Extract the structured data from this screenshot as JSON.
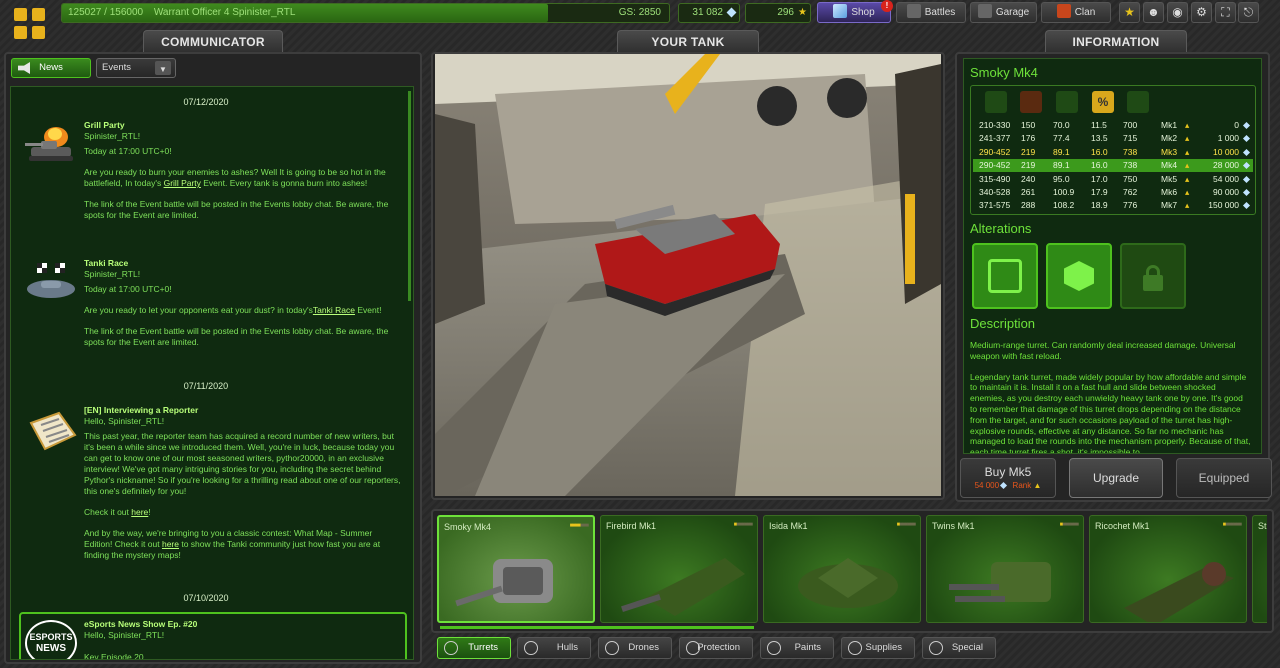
{
  "topbar": {
    "xp": "125027 / 156000",
    "xp_fraction": 0.8,
    "rank_name": "Warrant Officer 4 Spinister_RTL",
    "gs": "GS: 2850",
    "crystals": "31 082",
    "stars": "296",
    "shop": "Shop",
    "shop_badge": "!",
    "battles": "Battles",
    "garage": "Garage",
    "clan": "Clan"
  },
  "sections": {
    "communicator": "COMMUNICATOR",
    "your_tank": "YOUR TANK",
    "information": "INFORMATION"
  },
  "communicator": {
    "news_tab": "News",
    "events_dropdown": "Events",
    "dates": [
      "07/12/2020",
      "07/11/2020",
      "07/10/2020"
    ],
    "posts": [
      {
        "title": "Grill Party",
        "greeting": "Spinister_RTL!",
        "time": "Today at 17:00 UTC+0!",
        "p1a": "Are you ready to burn your enemies to ashes? Well It is going to be so hot in the battlefield, In today's ",
        "link": "Grill Party",
        "p1b": " Event. Every tank is gonna burn into ashes!",
        "p2": "The link of the Event battle will be posted in the Events lobby chat. Be aware, the spots for the Event are limited."
      },
      {
        "title": "Tanki Race",
        "greeting": "Spinister_RTL!",
        "time": "Today at 17:00 UTC+0!",
        "p1a": "Are you ready to let your opponents eat your dust? in today's",
        "link": "Tanki Race",
        "p1b": " Event!",
        "p2": "The link of the Event battle will be posted in the Events lobby chat. Be aware, the spots for the Event are limited."
      },
      {
        "title": "[EN] Interviewing a Reporter",
        "greeting": "Hello, Spinister_RTL!",
        "p1": "This past year, the reporter team has acquired a record number of new writers, but it's been a while since we introduced them. Well, you're in luck, because today you can get to know one of our most seasoned writers, pythor20000, in an exclusive interview! We've got many intriguing stories for you, including the secret behind Pythor's nickname! So if you're looking for a thrilling read about one of our reporters, this one's definitely for you!",
        "p2a": "Check it out ",
        "p2link": "here",
        "p2b": "!",
        "p3a": "And by the way, we're bringing to you a classic contest: What Map - Summer Edition! Check it out ",
        "p3link": "here",
        "p3b": " to show the Tanki community just how fast you are at finding the mystery maps!"
      },
      {
        "title": "eSports News Show Ep. #20",
        "greeting": "Hello, Spinister_RTL!",
        "tail": "Key Episode 20"
      }
    ],
    "esports_logo": [
      "ESPORTS",
      "NEWS"
    ]
  },
  "information": {
    "item_title": "Smoky Mk4",
    "stat_icons": [
      "damage-icon",
      "fire-rate-icon",
      "reload-icon",
      "critical-chance-icon",
      "critical-damage-icon"
    ],
    "rows": [
      {
        "c1": "210-330",
        "c2": "150",
        "c3": "70.0",
        "c4": "11.5",
        "c5": "700",
        "mk": "Mk1",
        "price": "0"
      },
      {
        "c1": "241-377",
        "c2": "176",
        "c3": "77.4",
        "c4": "13.5",
        "c5": "715",
        "mk": "Mk2",
        "price": "1 000"
      },
      {
        "c1": "290-452",
        "c2": "219",
        "c3": "89.1",
        "c4": "16.0",
        "c5": "738",
        "mk": "Mk3",
        "price": "10 000"
      },
      {
        "c1": "290-452",
        "c2": "219",
        "c3": "89.1",
        "c4": "16.0",
        "c5": "738",
        "mk": "Mk4",
        "price": "28 000"
      },
      {
        "c1": "315-490",
        "c2": "240",
        "c3": "95.0",
        "c4": "17.0",
        "c5": "750",
        "mk": "Mk5",
        "price": "54 000"
      },
      {
        "c1": "340-528",
        "c2": "261",
        "c3": "100.9",
        "c4": "17.9",
        "c5": "762",
        "mk": "Mk6",
        "price": "90 000"
      },
      {
        "c1": "371-575",
        "c2": "288",
        "c3": "108.2",
        "c4": "18.9",
        "c5": "776",
        "mk": "Mk7",
        "price": "150 000"
      }
    ],
    "alterations_heading": "Alterations",
    "description_heading": "Description",
    "desc1": "Medium-range turret. Can randomly deal increased damage. Universal weapon with fast reload.",
    "desc2": "Legendary tank turret, made widely popular by how affordable and simple to maintain it is. Install it on a fast hull and slide between shocked enemies, as you destroy each unwieldy heavy tank one by one. It's good to remember that damage of this turret drops depending on the distance from the target, and for such occasions payload of the turret has high-explosive rounds, effective at any distance. So far no mechanic has managed to load the rounds into the mechanism properly. Because of that, each time turret fires a shot, it's impossible to"
  },
  "actions": {
    "buy": "Buy Mk5",
    "buy_price": "54 000",
    "buy_rank": "Rank",
    "upgrade": "Upgrade",
    "equipped": "Equipped"
  },
  "items": [
    {
      "name": "Smoky Mk4",
      "stars": 4
    },
    {
      "name": "Firebird Mk1",
      "stars": 1
    },
    {
      "name": "Isida Mk1",
      "stars": 1
    },
    {
      "name": "Twins Mk1",
      "stars": 1
    },
    {
      "name": "Ricochet Mk1",
      "stars": 1
    },
    {
      "name": "Stri",
      "stars": 0
    }
  ],
  "categories": [
    "Turrets",
    "Hulls",
    "Drones",
    "Protection",
    "Paints",
    "Supplies",
    "Special"
  ],
  "colors": {
    "accent": "#4ec21e",
    "text_green": "#6ee23a",
    "highlight_row": "#3c9a1c",
    "gold": "#e8b21c"
  }
}
